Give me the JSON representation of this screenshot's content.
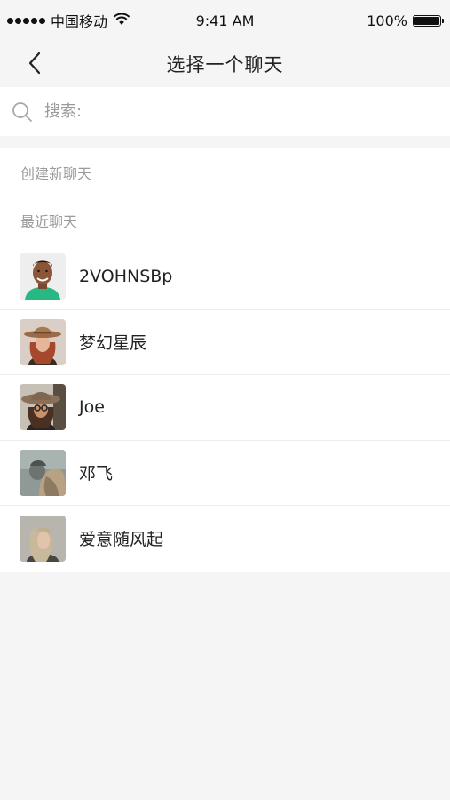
{
  "status_bar": {
    "carrier": "中国移动",
    "time": "9:41 AM",
    "battery_text": "100%",
    "battery_level": 1.0
  },
  "nav": {
    "back_icon": "chevron-left-icon",
    "title": "选择一个聊天"
  },
  "search": {
    "icon": "search-icon",
    "placeholder": "搜索:",
    "value": ""
  },
  "sections": {
    "create_new": "创建新聊天",
    "recent": "最近聊天"
  },
  "contacts": [
    {
      "name": "2VOHNSBp",
      "avatar": "avatar-man-smiling"
    },
    {
      "name": "梦幻星辰",
      "avatar": "avatar-woman-hat"
    },
    {
      "name": "Joe",
      "avatar": "avatar-woman-glasses-hat"
    },
    {
      "name": "邓飞",
      "avatar": "avatar-man-hood"
    },
    {
      "name": "爱意随风起",
      "avatar": "avatar-woman-blonde"
    }
  ],
  "colors": {
    "background": "#f5f5f5",
    "card": "#ffffff",
    "muted_text": "#9b9b9b",
    "divider": "#ececec"
  }
}
